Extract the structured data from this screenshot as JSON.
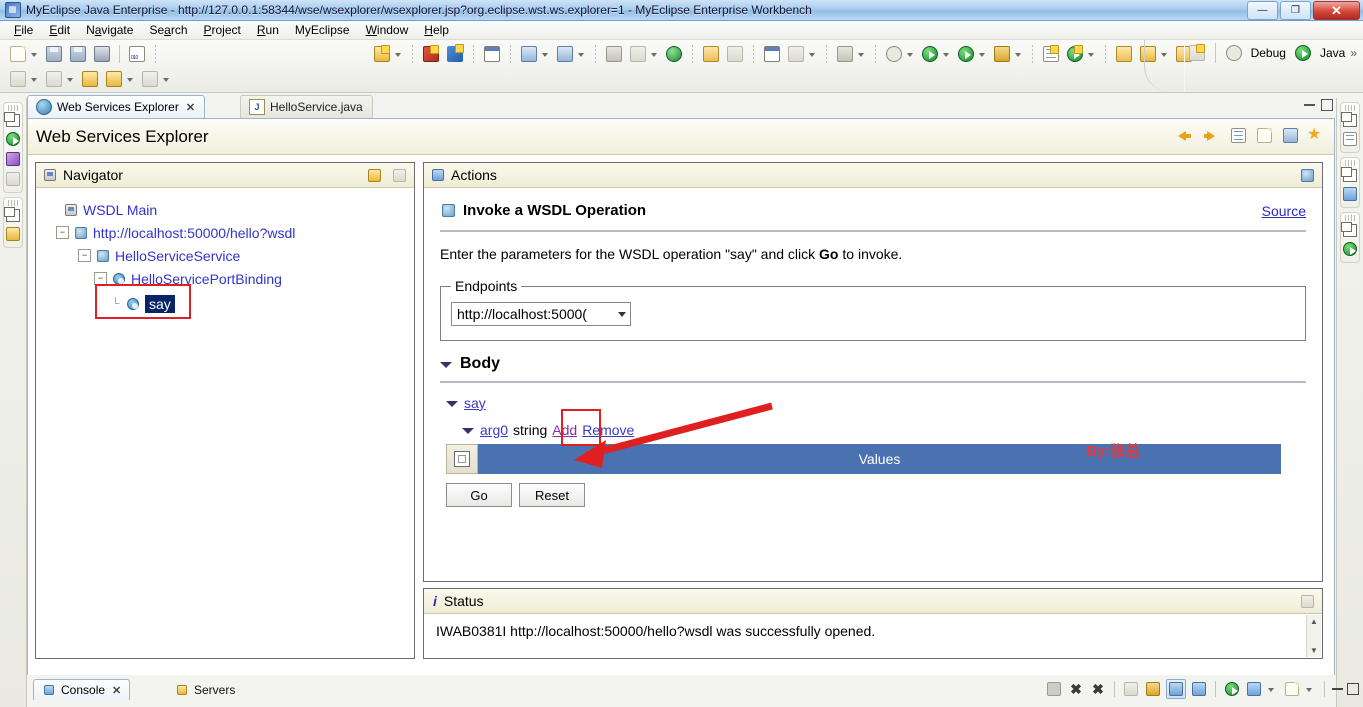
{
  "window": {
    "title": "MyEclipse Java Enterprise - http://127.0.0.1:58344/wse/wsexplorer/wsexplorer.jsp?org.eclipse.wst.ws.explorer=1 - MyEclipse Enterprise Workbench",
    "icon": "myeclipse-icon",
    "minimize_label": "—",
    "maximize_label": "❐",
    "close_label": "✕"
  },
  "menubar": {
    "items": [
      {
        "label": "File",
        "mnemonic": "F"
      },
      {
        "label": "Edit",
        "mnemonic": "E"
      },
      {
        "label": "Navigate",
        "mnemonic": "N"
      },
      {
        "label": "Search",
        "mnemonic": "S"
      },
      {
        "label": "Project",
        "mnemonic": "P"
      },
      {
        "label": "Run",
        "mnemonic": "R"
      },
      {
        "label": "MyEclipse",
        "mnemonic": "M"
      },
      {
        "label": "Window",
        "mnemonic": "W"
      },
      {
        "label": "Help",
        "mnemonic": "H"
      }
    ]
  },
  "toolbar": {
    "perspective": {
      "open_perspective_icon": "open-perspective-icon",
      "debug_icon": "debug-perspective-icon",
      "debug_label": "Debug",
      "java_icon": "java-perspective-icon",
      "java_label": "Java",
      "overflow_label": "»"
    }
  },
  "editor_tabs": {
    "tabs": [
      {
        "label": "Web Services Explorer",
        "icon": "web-services-explorer-icon",
        "active": true,
        "close_label": "✕"
      },
      {
        "label": "HelloService.java",
        "icon": "java-file-icon",
        "active": false
      }
    ]
  },
  "view": {
    "title": "Web Services Explorer",
    "toolbar_icons": [
      "back-icon",
      "forward-icon",
      "properties-icon",
      "open-wsdl-page-icon",
      "preferences-icon",
      "favorites-icon"
    ]
  },
  "navigator": {
    "title": "Navigator",
    "icon": "navigator-icon",
    "tools": [
      "link-icon",
      "maximize-panel-icon"
    ],
    "tree": [
      {
        "label": "WSDL Main",
        "icon": "wsdl-main-icon",
        "depth": 0,
        "expander": "none",
        "selected": false
      },
      {
        "label": "http://localhost:50000/hello?wsdl",
        "icon": "wsdl-service-icon",
        "depth": 1,
        "expander": "minus",
        "selected": false
      },
      {
        "label": "HelloServiceService",
        "icon": "service-icon",
        "depth": 2,
        "expander": "minus",
        "selected": false
      },
      {
        "label": "HelloServicePortBinding",
        "icon": "binding-icon",
        "depth": 3,
        "expander": "minus",
        "selected": false
      },
      {
        "label": "say",
        "icon": "operation-icon",
        "depth": 4,
        "expander": "leaf",
        "selected": true
      }
    ]
  },
  "actions": {
    "title": "Actions",
    "icon": "actions-icon",
    "tool_icon": "open-in-browser-icon",
    "heading": "Invoke a WSDL Operation",
    "heading_icon": "wsdl-operation-icon",
    "source_link": "Source",
    "description_prefix": "Enter the parameters for the WSDL operation \"say\" and click ",
    "description_bold": "Go",
    "description_suffix": " to invoke.",
    "endpoints": {
      "legend": "Endpoints",
      "selected_value": "http://localhost:5000(",
      "dropdown_icon": "chevron-down-icon"
    },
    "body": {
      "label": "Body",
      "twisty_icon": "twisty-down-icon",
      "operation_link": "say",
      "arg_name": "arg0",
      "arg_type": "string",
      "add_link": "Add",
      "remove_link": "Remove",
      "table_header": "Values",
      "table_checkbox_icon": "select-all-checkbox-icon"
    },
    "buttons": {
      "go": "Go",
      "reset": "Reset"
    },
    "annotation": {
      "text": "By:张总",
      "color": "#e03a3a",
      "arrow_color": "#e02020",
      "highlight_color": "#e02020"
    }
  },
  "status": {
    "title": "Status",
    "icon": "info-icon",
    "tool_icon": "maximize-panel-icon",
    "message": "IWAB0381I http://localhost:50000/hello?wsdl was successfully opened.",
    "scroll_up": "▲",
    "scroll_down": "▼"
  },
  "bottom_tabs": {
    "tabs": [
      {
        "label": "Console",
        "icon": "console-icon",
        "active": true,
        "close_label": "✕"
      },
      {
        "label": "Servers",
        "icon": "servers-icon",
        "active": false
      }
    ],
    "tools": [
      "terminate-icon",
      "remove-launch-icon",
      "remove-all-terminated-icon",
      "clear-console-icon",
      "scroll-lock-icon",
      "pin-console-icon",
      "display-selected-console-icon",
      "open-console-icon",
      "new-console-view-icon"
    ],
    "minimize_label": "—",
    "maximize_label": "❐"
  },
  "fastview": {
    "left": [
      "restore-icon",
      "debug-view-icon",
      "variables-view-icon",
      "breakpoints-view-icon",
      "restore-icon",
      "servers-view-icon"
    ],
    "right": [
      "restore-icon",
      "outline-view-icon",
      "restore-icon",
      "package-explorer-icon",
      "restore-icon",
      "junit-view-icon"
    ]
  },
  "colors": {
    "title_bar": "#a8cdee",
    "selection": "#0a246a",
    "table_header": "#4a72b0",
    "link": "#3a3ac0",
    "visited_link": "#8a2fa8",
    "annotation_red": "#e02020"
  }
}
